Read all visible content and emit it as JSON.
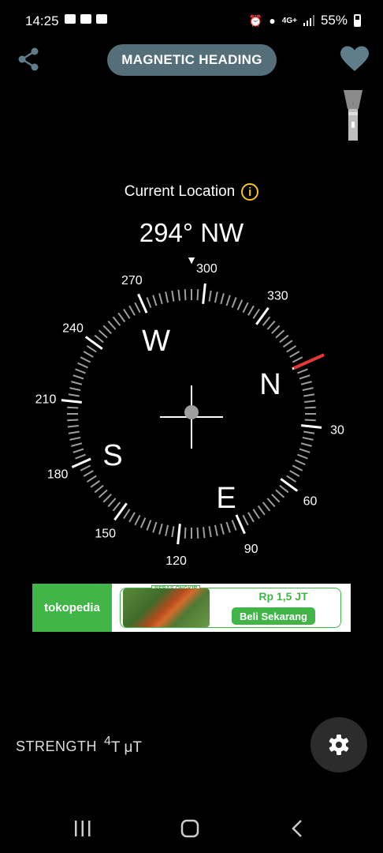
{
  "status_bar": {
    "time": "14:25",
    "network": "4G+",
    "battery": "55%"
  },
  "header": {
    "title": "MAGNETIC HEADING",
    "share_icon": "share-icon",
    "favorite_icon": "heart-icon",
    "flashlight_icon": "flashlight-icon"
  },
  "location": {
    "label": "Current Location",
    "info_glyph": "i"
  },
  "heading": {
    "readout": "294° NW",
    "value_deg": 294
  },
  "compass": {
    "scale_labels": [
      "300",
      "330",
      "30",
      "60",
      "90",
      "120",
      "150",
      "180",
      "210",
      "240",
      "270"
    ],
    "cardinals": {
      "N": "N",
      "E": "E",
      "S": "S",
      "W": "W"
    },
    "north_marker_color": "#e53935",
    "indicator_glyph": "▼"
  },
  "ad": {
    "brand": "tokopedia",
    "badge": "BEBAS ONGKIR",
    "price": "Rp 1,5 JT",
    "cta": "Beli Sekarang",
    "accent": "#42b549"
  },
  "strength": {
    "label": "STRENGTH",
    "value": "4",
    "unit": "T μT"
  },
  "colors": {
    "pill": "#546e7a",
    "info": "#f5c518"
  }
}
